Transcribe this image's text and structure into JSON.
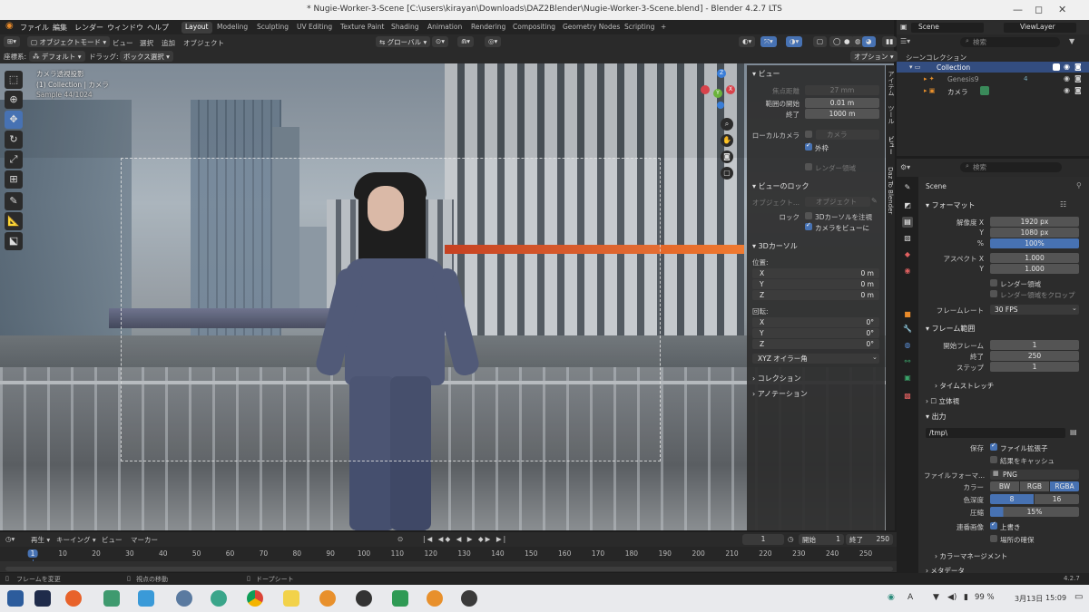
{
  "window": {
    "title": "* Nugie-Worker-3-Scene [C:\\users\\kirayan\\Downloads\\DAZ2Blender\\Nugie-Worker-3-Scene.blend] - Blender 4.2.7 LTS",
    "minimize": "—",
    "maximize": "◻",
    "close": "✕"
  },
  "menu": [
    "ファイル",
    "編集",
    "レンダー",
    "ウィンドウ",
    "ヘルプ"
  ],
  "workspaces": [
    "Layout",
    "Modeling",
    "Sculpting",
    "UV Editing",
    "Texture Paint",
    "Shading",
    "Animation",
    "Rendering",
    "Compositing",
    "Geometry Nodes",
    "Scripting",
    "+"
  ],
  "scene_selector": {
    "scene": "Scene",
    "view_layer": "ViewLayer"
  },
  "viewport_header": {
    "mode": "オブジェクトモード",
    "view": "ビュー",
    "select": "選択",
    "add": "追加",
    "object": "オブジェクト",
    "transform": "グローバル",
    "coord_label": "座標系:",
    "coord_value": "デフォルト",
    "drag_label": "ドラッグ:",
    "drag_value": "ボックス選択",
    "options": "オプション"
  },
  "viewport_overlay": {
    "line1": "カメラ透視投影",
    "line2": "(1) Collection | カメラ",
    "line3": "Sample 44/1024"
  },
  "npanel": {
    "tabs": [
      "アイテム",
      "ツール",
      "ビュー",
      "Daz To Blender"
    ],
    "view_section": "ビュー",
    "focal_label": "焦点距離",
    "focal_value": "27 mm",
    "clip_start_label": "範囲の開始",
    "clip_start_value": "0.01 m",
    "clip_end_label": "終了",
    "clip_end_value": "1000 m",
    "local_camera_label": "ローカルカメラ",
    "local_camera_value": "カメラ",
    "frame_label": "外枠",
    "render_region_label": "レンダー領域",
    "view_lock_section": "ビューのロック",
    "lock_object_label": "オブジェクト...",
    "lock_object_value": "オブジェクト",
    "lock_label": "ロック",
    "lock_cursor_label": "3Dカーソルを注視",
    "camera_to_view_label": "カメラをビューに",
    "cursor_section": "3Dカーソル",
    "location_label": "位置:",
    "rotation_label": "回転:",
    "x": "X",
    "y": "Y",
    "z": "Z",
    "loc_x": "0 m",
    "loc_y": "0 m",
    "loc_z": "0 m",
    "rot_x": "0°",
    "rot_y": "0°",
    "rot_z": "0°",
    "rotation_mode": "XYZ オイラー角",
    "collection_section": "コレクション",
    "annotation_section": "アノテーション"
  },
  "outliner": {
    "search_placeholder": "検索",
    "scene_collection": "シーンコレクション",
    "items": [
      {
        "name": "Collection"
      },
      {
        "name": "Genesis9",
        "badge": "4"
      },
      {
        "name": "カメラ"
      }
    ]
  },
  "properties": {
    "search_placeholder": "検索",
    "scene_name": "Scene",
    "format_section": "フォーマット",
    "res_x_label": "解像度 X",
    "res_x": "1920 px",
    "res_y_label": "Y",
    "res_y": "1080 px",
    "res_pct_label": "%",
    "res_pct": "100%",
    "aspect_x_label": "アスペクト X",
    "aspect_x": "1.000",
    "aspect_y_label": "Y",
    "aspect_y": "1.000",
    "render_region": "レンダー領域",
    "crop_region": "レンダー領域をクロップ",
    "framerate_label": "フレームレート",
    "framerate": "30 FPS",
    "frame_range_section": "フレーム範囲",
    "frame_start_label": "開始フレーム",
    "frame_start": "1",
    "frame_end_label": "終了",
    "frame_end": "250",
    "frame_step_label": "ステップ",
    "frame_step": "1",
    "time_stretch": "タイムストレッチ",
    "stereoscopy": "立体視",
    "output_section": "出力",
    "output_path": "/tmp\\",
    "save_label": "保存",
    "file_ext": "ファイル拡張子",
    "cache_result": "結果をキャッシュ",
    "file_format_label": "ファイルフォーマ...",
    "file_format": "PNG",
    "color_label": "カラー",
    "color_bw": "BW",
    "color_rgb": "RGB",
    "color_rgba": "RGBA",
    "depth_label": "色深度",
    "depth_8": "8",
    "depth_16": "16",
    "compress_label": "圧縮",
    "compress": "15%",
    "image_seq_label": "連番画像",
    "overwrite": "上書き",
    "placeholders": "場所の確保",
    "color_mgmt": "カラーマネージメント",
    "metadata": "メタデータ"
  },
  "timeline": {
    "playback": "再生",
    "keying": "キーイング",
    "view": "ビュー",
    "marker": "マーカー",
    "current_frame": "1",
    "start_label": "開始",
    "start": "1",
    "end_label": "終了",
    "end": "250",
    "ticks": [
      "1",
      "10",
      "20",
      "30",
      "40",
      "50",
      "60",
      "70",
      "80",
      "90",
      "100",
      "110",
      "120",
      "130",
      "140",
      "150",
      "160",
      "170",
      "180",
      "190",
      "200",
      "210",
      "220",
      "230",
      "240",
      "250"
    ]
  },
  "statusbar": {
    "left1": "フレームを変更",
    "left2": "視点の移動",
    "left3": "ドープシート",
    "version": "4.2.7"
  },
  "taskbar": {
    "battery": "99 %",
    "date": "3月13日",
    "time": "15:09",
    "ime": "A"
  },
  "colors": {
    "accent": "#4772b3",
    "bg": "#1d1d1d"
  }
}
